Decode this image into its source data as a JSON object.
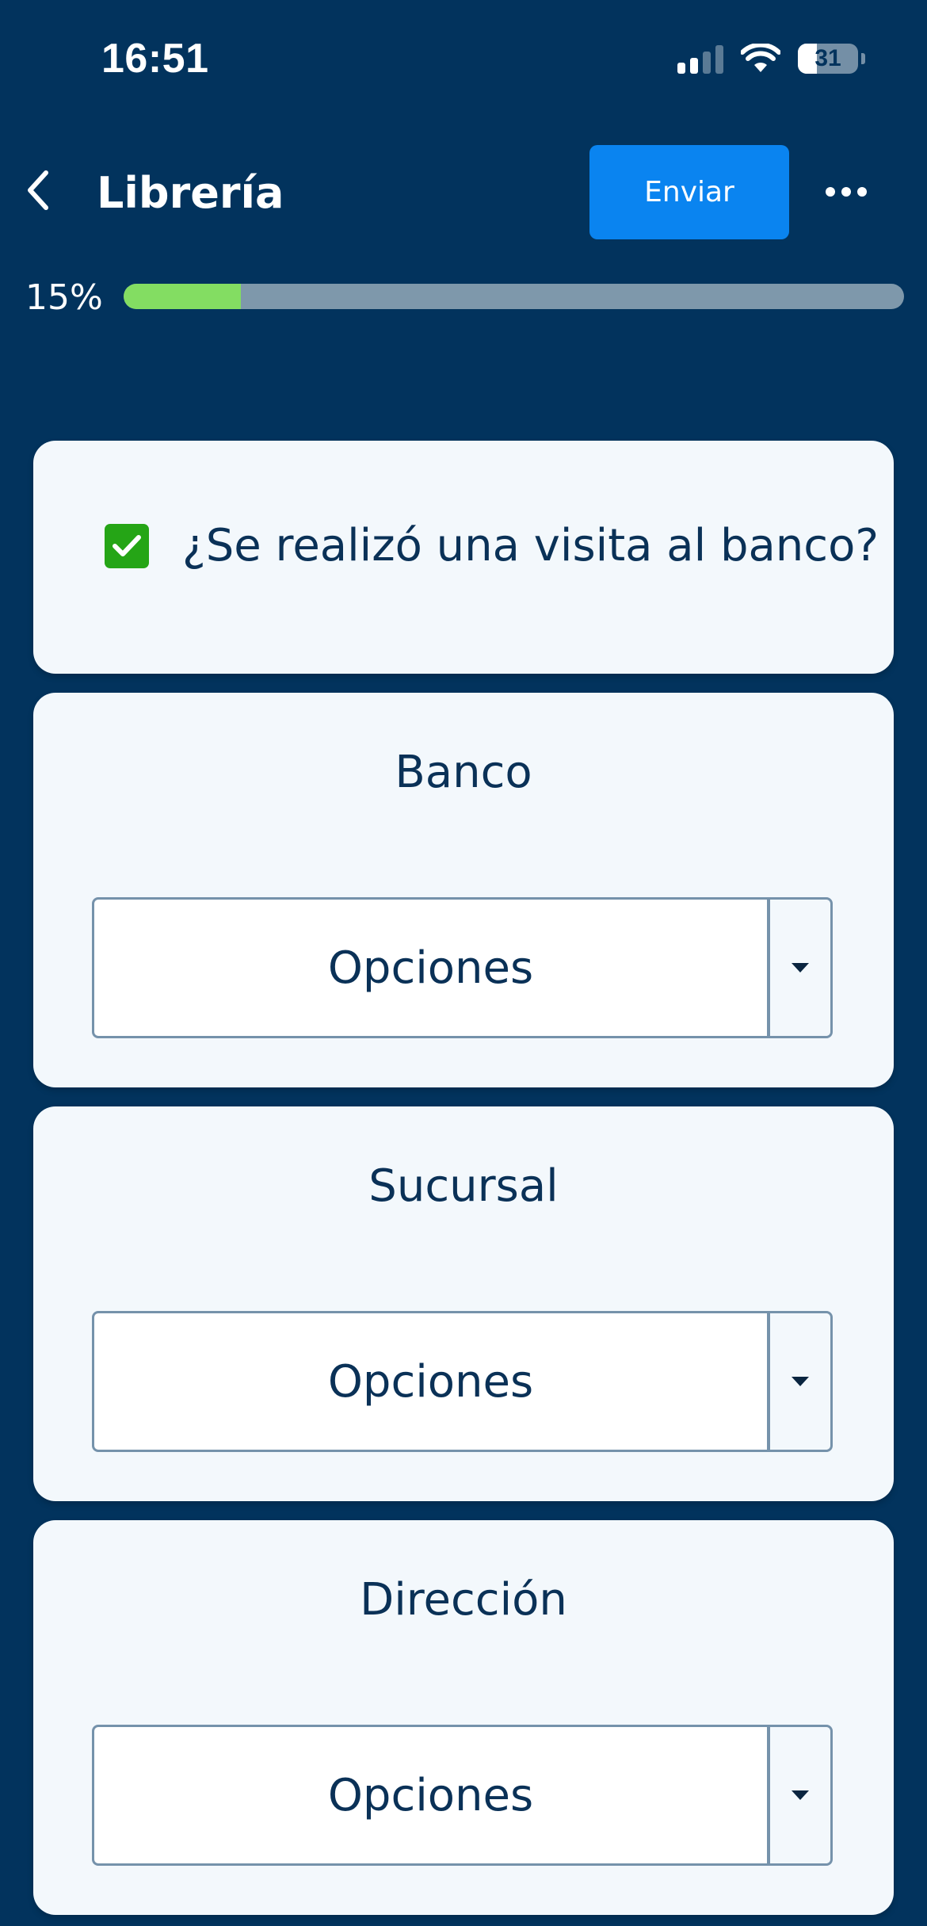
{
  "status_bar": {
    "time": "16:51",
    "battery_level": "31",
    "icons": [
      "cellular-signal-icon",
      "wifi-icon",
      "battery-icon"
    ]
  },
  "header": {
    "back_icon": "chevron-left-icon",
    "title": "Librería",
    "send_label": "Enviar",
    "more_icon": "ellipsis-icon"
  },
  "progress": {
    "label": "15%",
    "value": 0.15
  },
  "question": {
    "checked": true,
    "text": "¿Se realizó una visita al banco?"
  },
  "fields": [
    {
      "label": "Banco",
      "value": "Opciones"
    },
    {
      "label": "Sucursal",
      "value": "Opciones"
    },
    {
      "label": "Dirección",
      "value": "Opciones"
    }
  ],
  "colors": {
    "background": "#02335d",
    "accent": "#0a84f0",
    "progress_fill": "#83dd62",
    "checkbox": "#25a516",
    "text_dark": "#0a3157",
    "card": "#f3f8fc"
  }
}
